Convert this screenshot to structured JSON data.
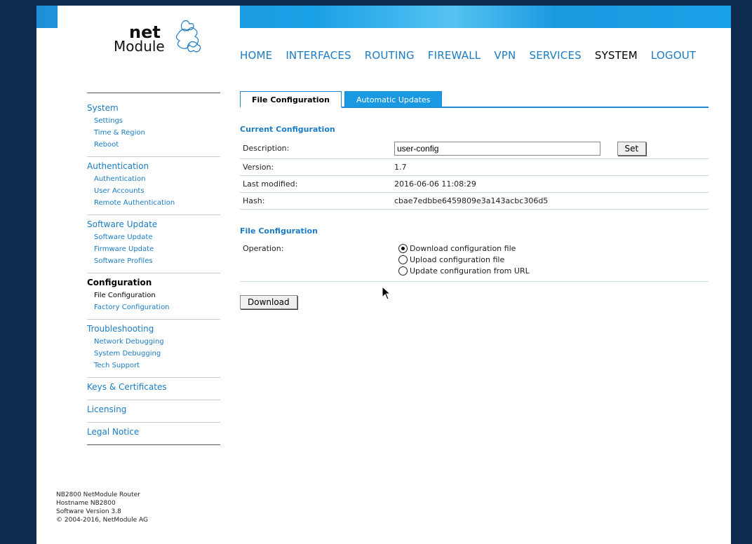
{
  "brand": {
    "logo_top": "net",
    "logo_bottom": "Module"
  },
  "nav": [
    {
      "label": "HOME",
      "active": false
    },
    {
      "label": "INTERFACES",
      "active": false
    },
    {
      "label": "ROUTING",
      "active": false
    },
    {
      "label": "FIREWALL",
      "active": false
    },
    {
      "label": "VPN",
      "active": false
    },
    {
      "label": "SERVICES",
      "active": false
    },
    {
      "label": "SYSTEM",
      "active": true
    },
    {
      "label": "LOGOUT",
      "active": false
    }
  ],
  "sidebar": {
    "system": {
      "title": "System",
      "items": [
        "Settings",
        "Time & Region",
        "Reboot"
      ]
    },
    "authentication": {
      "title": "Authentication",
      "items": [
        "Authentication",
        "User Accounts",
        "Remote Authentication"
      ]
    },
    "software_update": {
      "title": "Software Update",
      "items": [
        "Software Update",
        "Firmware Update",
        "Software Profiles"
      ]
    },
    "configuration": {
      "title": "Configuration",
      "items": [
        "File Configuration",
        "Factory Configuration"
      ]
    },
    "troubleshooting": {
      "title": "Troubleshooting",
      "items": [
        "Network Debugging",
        "System Debugging",
        "Tech Support"
      ]
    },
    "keys": {
      "title": "Keys & Certificates"
    },
    "licensing": {
      "title": "Licensing"
    },
    "legal": {
      "title": "Legal Notice"
    }
  },
  "footer": {
    "line1": "NB2800 NetModule Router",
    "line2": "Hostname NB2800",
    "line3": "Software Version 3.8",
    "line4": "© 2004-2016, NetModule AG"
  },
  "tabs": {
    "file_config": "File Configuration",
    "auto_updates": "Automatic Updates"
  },
  "current": {
    "title": "Current Configuration",
    "description_label": "Description:",
    "description_value": "user-config",
    "set_label": "Set",
    "version_label": "Version:",
    "version_value": "1.7",
    "modified_label": "Last modified:",
    "modified_value": "2016-06-06 11:08:29",
    "hash_label": "Hash:",
    "hash_value": "cbae7edbbe6459809e3a143acbc306d5"
  },
  "file_config": {
    "title": "File Configuration",
    "operation_label": "Operation:",
    "options": [
      "Download configuration file",
      "Upload configuration file",
      "Update configuration from URL"
    ],
    "selected": 0,
    "download_label": "Download"
  }
}
